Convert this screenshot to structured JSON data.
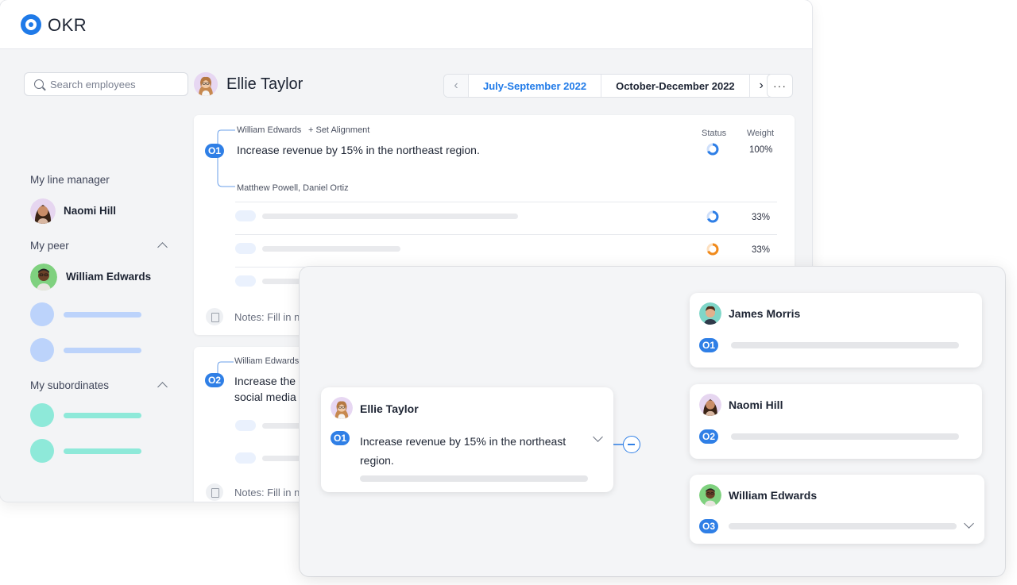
{
  "app": {
    "title": "OKR"
  },
  "search": {
    "placeholder": "Search employees"
  },
  "profile": {
    "name": "Ellie Taylor"
  },
  "periods": {
    "previous": "July-September 2022",
    "current": "October-December 2022",
    "more_label": "···"
  },
  "sidebar": {
    "line_manager_label": "My line manager",
    "line_manager": "Naomi Hill",
    "peer_label": "My peer",
    "peer": "William Edwards",
    "subordinates_label": "My subordinates"
  },
  "okrs": [
    {
      "badge": "O1",
      "parent": "William Edwards",
      "set_alignment": "+ Set Alignment",
      "title": "Increase revenue by 15% in the northeast region.",
      "aligned": "Matthew Powell, Daniel Ortiz",
      "status_label": "Status",
      "weight_label": "Weight",
      "weight": "100%",
      "key_results": [
        {
          "weight": "33%"
        },
        {
          "weight": "33%"
        }
      ],
      "notes": "Notes: Fill in n"
    },
    {
      "badge": "O2",
      "parent": "William Edwards",
      "title_line1": "Increase the",
      "title_line2": "social media",
      "notes": "Notes: Fill in n"
    }
  ],
  "alignment": {
    "owner": {
      "name": "Ellie Taylor",
      "badge": "O1",
      "title": "Increase revenue by 15% in the northeast region."
    },
    "children": [
      {
        "name": "James Morris",
        "badge": "O1"
      },
      {
        "name": "Naomi Hill",
        "badge": "O2"
      },
      {
        "name": "William Edwards",
        "badge": "O3"
      }
    ]
  },
  "colors": {
    "accent": "#1f7ae8",
    "status_blue": "#2f7fe6",
    "status_orange": "#f08a1c",
    "peer_placeholder": "#bcd3fb",
    "subordinate_placeholder": "#8ee9d9"
  },
  "icons": [
    "search-icon",
    "chevron-left-icon",
    "chevron-right-icon",
    "more-icon",
    "chevron-up-icon",
    "chevron-down-icon",
    "notes-icon",
    "collapse-icon"
  ]
}
